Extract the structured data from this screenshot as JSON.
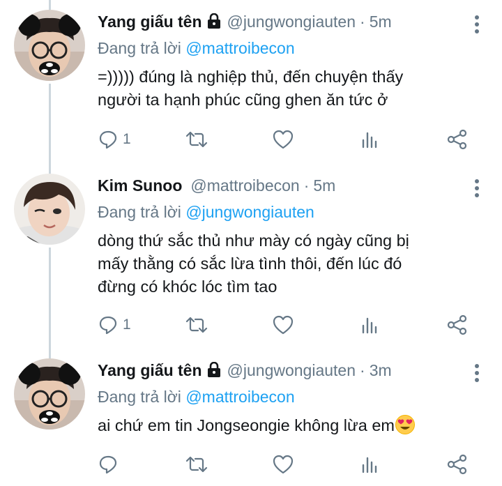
{
  "tweets": [
    {
      "name": "Yang giấu tên",
      "handle": "@jungwongiauten",
      "sep": "·",
      "time": "5m",
      "reply_prefix": "Đang trả lời",
      "reply_to": "@mattroibecon",
      "lines": [
        "=))))) đúng là nghiệp thủ, đến chuyện thấy",
        "người ta hạnh phúc cũng ghen ăn tức ở"
      ],
      "reply_count": "1",
      "protected": true,
      "avatar": "masked-avatar"
    },
    {
      "name": "Kim Sunoo",
      "handle": "@mattroibecon",
      "sep": "·",
      "time": "5m",
      "reply_prefix": "Đang trả lời",
      "reply_to": "@jungwongiauten",
      "lines": [
        "dòng thứ sắc thủ như mày có ngày cũng bị",
        "mấy thằng có sắc lừa tình thôi, đến lúc đó",
        "đừng có khóc lóc tìm tao"
      ],
      "reply_count": "1",
      "protected": false,
      "avatar": "winking-avatar"
    },
    {
      "name": "Yang giấu tên",
      "handle": "@jungwongiauten",
      "sep": "·",
      "time": "3m",
      "reply_prefix": "Đang trả lời",
      "reply_to": "@mattroibecon",
      "lines": [
        "ai chứ em tin Jongseongie không lừa em"
      ],
      "emoji": "heart-eyes-emoji",
      "reply_count": "",
      "protected": true,
      "avatar": "masked-avatar"
    }
  ],
  "colors": {
    "accent": "#1da1f2",
    "secondary": "#657786",
    "thread_line": "#ccd6dd"
  }
}
